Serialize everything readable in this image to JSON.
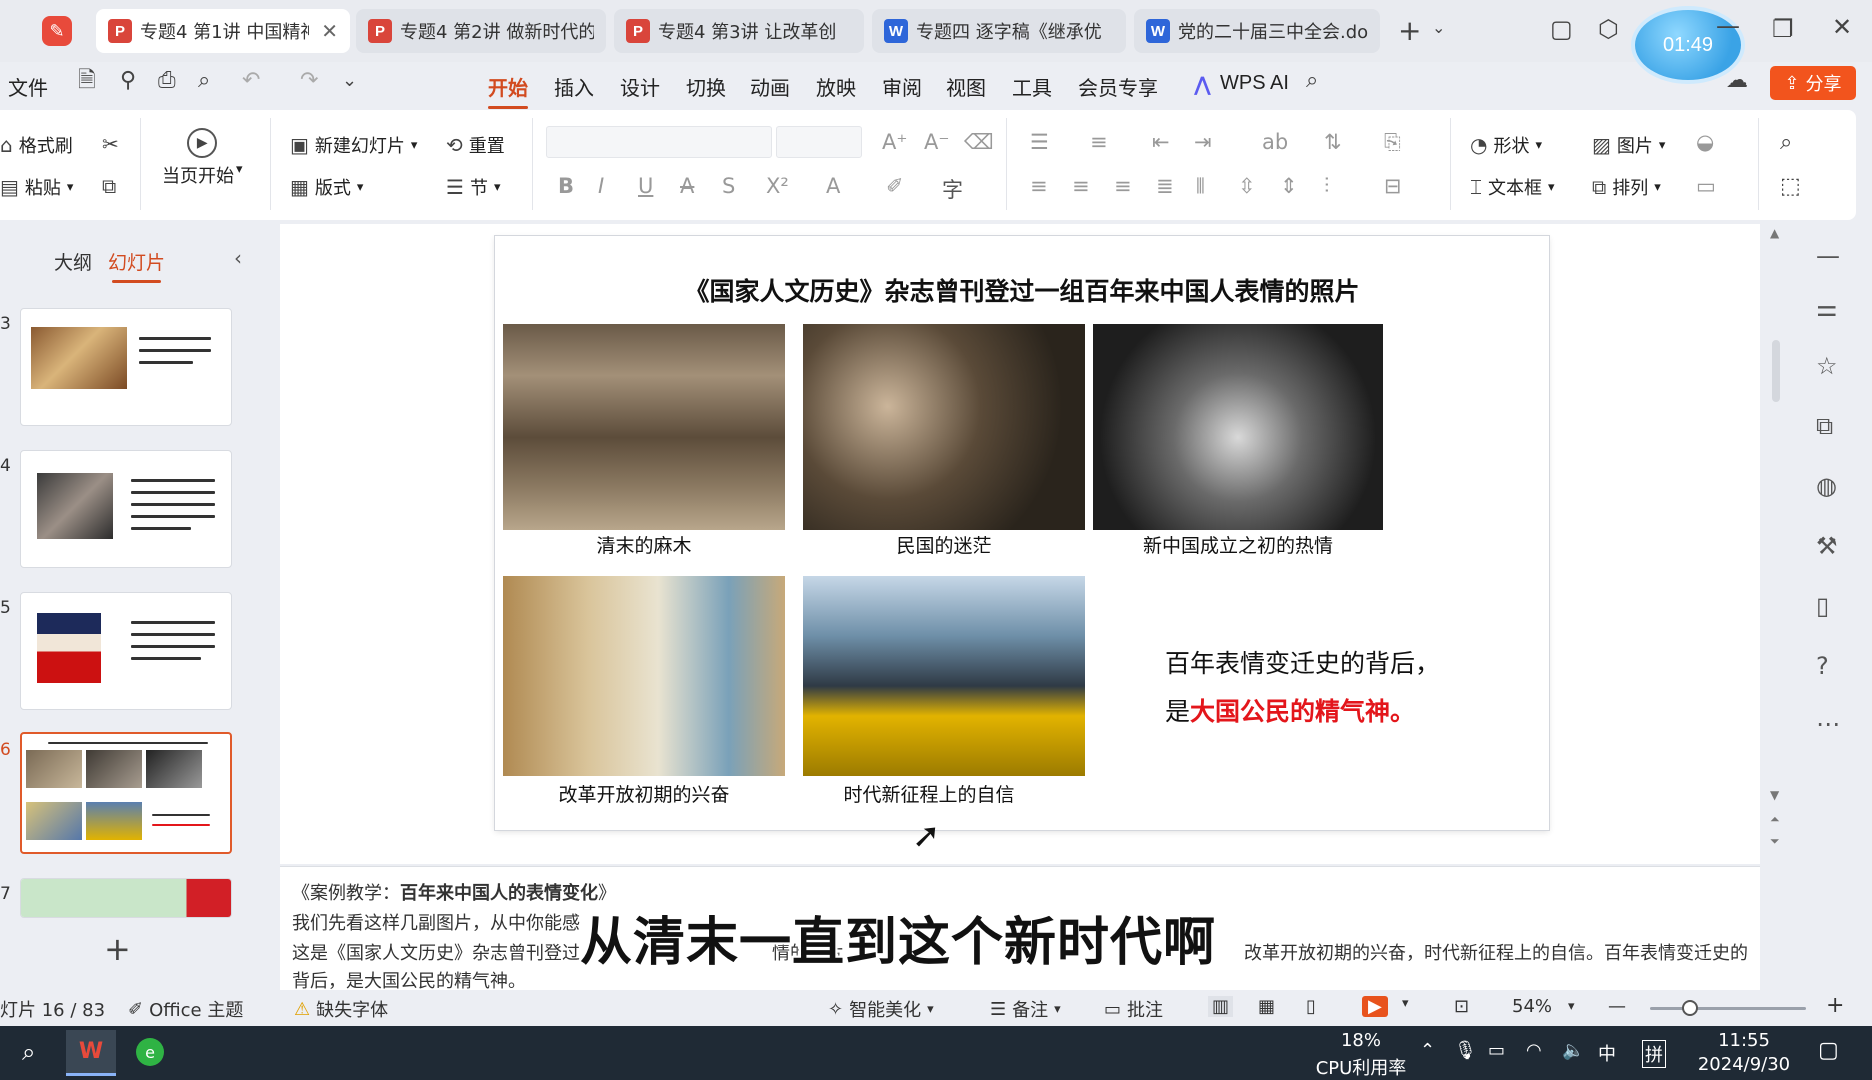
{
  "tabs": [
    {
      "title": "专题4 第1讲 中国精神",
      "app": "P",
      "active": true
    },
    {
      "title": "专题4 第2讲 做新时代的",
      "app": "P",
      "active": false
    },
    {
      "title": "专题4 第3讲 让改革创",
      "app": "P",
      "active": false
    },
    {
      "title": "专题四 逐字稿《继承优",
      "app": "W",
      "active": false
    },
    {
      "title": "党的二十届三中全会.do",
      "app": "W",
      "active": false
    }
  ],
  "timer": "01:49",
  "menu": {
    "file": "文件",
    "items": [
      "开始",
      "插入",
      "设计",
      "切换",
      "动画",
      "放映",
      "审阅",
      "视图",
      "工具",
      "会员专享"
    ],
    "wps_ai": "WPS AI",
    "share": "分享"
  },
  "ribbon": {
    "format_painter": "格式刷",
    "paste": "粘贴",
    "from_current": "当页开始",
    "new_slide": "新建幻灯片",
    "reset": "重置",
    "layout": "版式",
    "section": "节",
    "shape": "形状",
    "picture": "图片",
    "textbox": "文本框",
    "arrange": "排列"
  },
  "left_panel": {
    "tab_outline": "大纲",
    "tab_slides": "幻灯片",
    "slide_numbers": [
      "3",
      "4",
      "5",
      "6",
      "7"
    ]
  },
  "slide": {
    "title": "《国家人文历史》杂志曾刊登过一组百年来中国人表情的照片",
    "captions": [
      "清末的麻木",
      "民国的迷茫",
      "新中国成立之初的热情",
      "改革开放初期的兴奋",
      "时代新征程上的自信"
    ],
    "side_line1": "百年表情变迁史的背后，",
    "side_line2_prefix": "是",
    "side_line2_red": "大国公民的精气神。"
  },
  "notes": {
    "line1_prefix": "《案例教学：",
    "line1_bold": "百年来中国人的表情变化",
    "line1_suffix": "》",
    "line2": "我们先看这样几副图片，从中你能感",
    "line3_left": "这是《国家人文历史》杂志曾刊登过",
    "line3_mid": "情的照片",
    "line3_mid2": "的",
    "line3_right": "改革开放初期的兴奋，时代新征程上的自信。百年表情变迁史的",
    "line4": "背后，是大国公民的精气神。"
  },
  "subtitle": "从清末一直到这个新时代啊",
  "status": {
    "slide_counter": "幻灯片 16 / 83",
    "theme": "Office 主题",
    "missing_font": "缺失字体",
    "smart_beautify": "智能美化",
    "notes": "备注",
    "comment": "批注",
    "zoom": "54%"
  },
  "taskbar": {
    "cpu_percent": "18%",
    "cpu_label": "CPU利用率",
    "ime1": "中",
    "ime2": "拼",
    "time": "11:55",
    "date": "2024/9/30"
  },
  "colors": {
    "accent": "#d24b20",
    "share_button": "#f2541d",
    "highlight_red": "#e3161b"
  }
}
